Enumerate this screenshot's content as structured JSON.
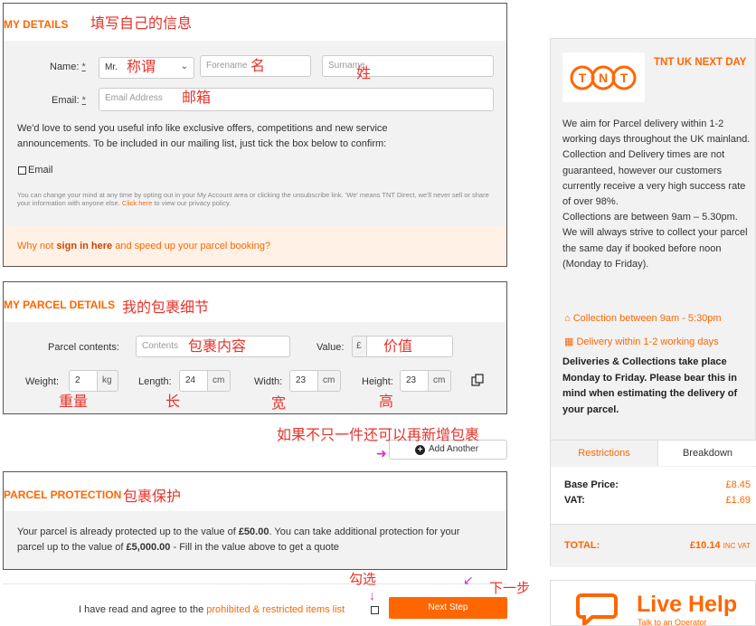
{
  "my_details": {
    "title": "MY DETAILS",
    "annotation": "填写自己的信息",
    "name_label": "Name:",
    "email_label": "Email:",
    "required_mark": "*",
    "title_select_value": "Mr.",
    "title_annotation": "称谓",
    "forename_placeholder": "Forename",
    "forename_annotation": "名",
    "surname_placeholder": "Surname",
    "surname_annotation": "姓",
    "email_placeholder": "Email Address",
    "email_annotation": "邮箱",
    "mailing_text": "We'd love to send you useful info like exclusive offers, competitions and new service announcements. To be included in our mailing list, just tick the box below to confirm:",
    "email_checkbox_label": "Email",
    "fine_print": "You can change your mind at any time by opting out in your My Account area or clicking the unsubscribe link. 'We' means TNT Direct, we'll never sell or share your information with anyone else.",
    "fine_print_link": "Click here",
    "fine_print_tail": "to view our privacy policy.",
    "signin_prefix": "Why not",
    "signin_link": "sign in here",
    "signin_suffix": "and speed up your parcel booking?"
  },
  "parcel_details": {
    "title": "MY PARCEL DETAILS",
    "annotation": "我的包裹细节",
    "contents_label": "Parcel contents:",
    "contents_placeholder": "Contents",
    "contents_annotation": "包裹内容",
    "value_label": "Value:",
    "value_prefix": "£",
    "value_annotation": "价值",
    "weight_label": "Weight:",
    "weight_value": "2",
    "weight_unit": "kg",
    "weight_annotation": "重量",
    "length_label": "Length:",
    "length_value": "24",
    "length_unit": "cm",
    "length_annotation": "长",
    "width_label": "Width:",
    "width_value": "23",
    "width_unit": "cm",
    "width_annotation": "宽",
    "height_label": "Height:",
    "height_value": "23",
    "height_unit": "cm",
    "height_annotation": "高"
  },
  "add_another": {
    "annotation": "如果不只一件还可以再新增包裹",
    "button_label": "Add Another"
  },
  "protection": {
    "title": "PARCEL PROTECTION",
    "annotation": "包裹保护",
    "text_1": "Your parcel is already protected up to the value of",
    "amount_1": "£50.00",
    "text_2": ". You can take additional protection for your parcel up to the value of",
    "amount_2": "£5,000.00",
    "text_3": " - Fill in the value above to get a quote"
  },
  "footer": {
    "agree_prefix": "I have read and agree to the",
    "agree_link": "prohibited & restricted items list",
    "check_annotation": "勾选",
    "next_button": "Next Step",
    "next_annotation": "下一步"
  },
  "sidebar": {
    "service_name": "TNT UK NEXT DAY",
    "logo_text": "TNT",
    "description": "We aim for Parcel delivery within 1-2 working days throughout the UK mainland.\nCollection and Delivery times are not guaranteed, however our customers currently receive a very high success rate of over 98%.\nCollections are between 9am – 5.30pm. We will always strive to collect your parcel the same day if booked before noon (Monday to Friday).",
    "collection_info": "Collection between 9am - 5:30pm",
    "delivery_info": "Delivery within 1-2 working days",
    "weekday_note": "Deliveries & Collections take place Monday to Friday. Please bear this in mind when estimating the delivery of your parcel.",
    "tabs": [
      "Restrictions",
      "Breakdown"
    ],
    "base_price_label": "Base Price:",
    "base_price_value": "£8.45",
    "vat_label": "VAT:",
    "vat_value": "£1.69",
    "total_label": "TOTAL:",
    "total_value": "£10.14",
    "total_suffix": "INC VAT",
    "live_help_title": "Live Help",
    "live_help_sub": "Talk to an Operator"
  },
  "colors": {
    "accent": "#ff6600",
    "annotation": "#e5332a",
    "arrow": "#d630c8",
    "panel_bg": "#f2f2f2"
  }
}
